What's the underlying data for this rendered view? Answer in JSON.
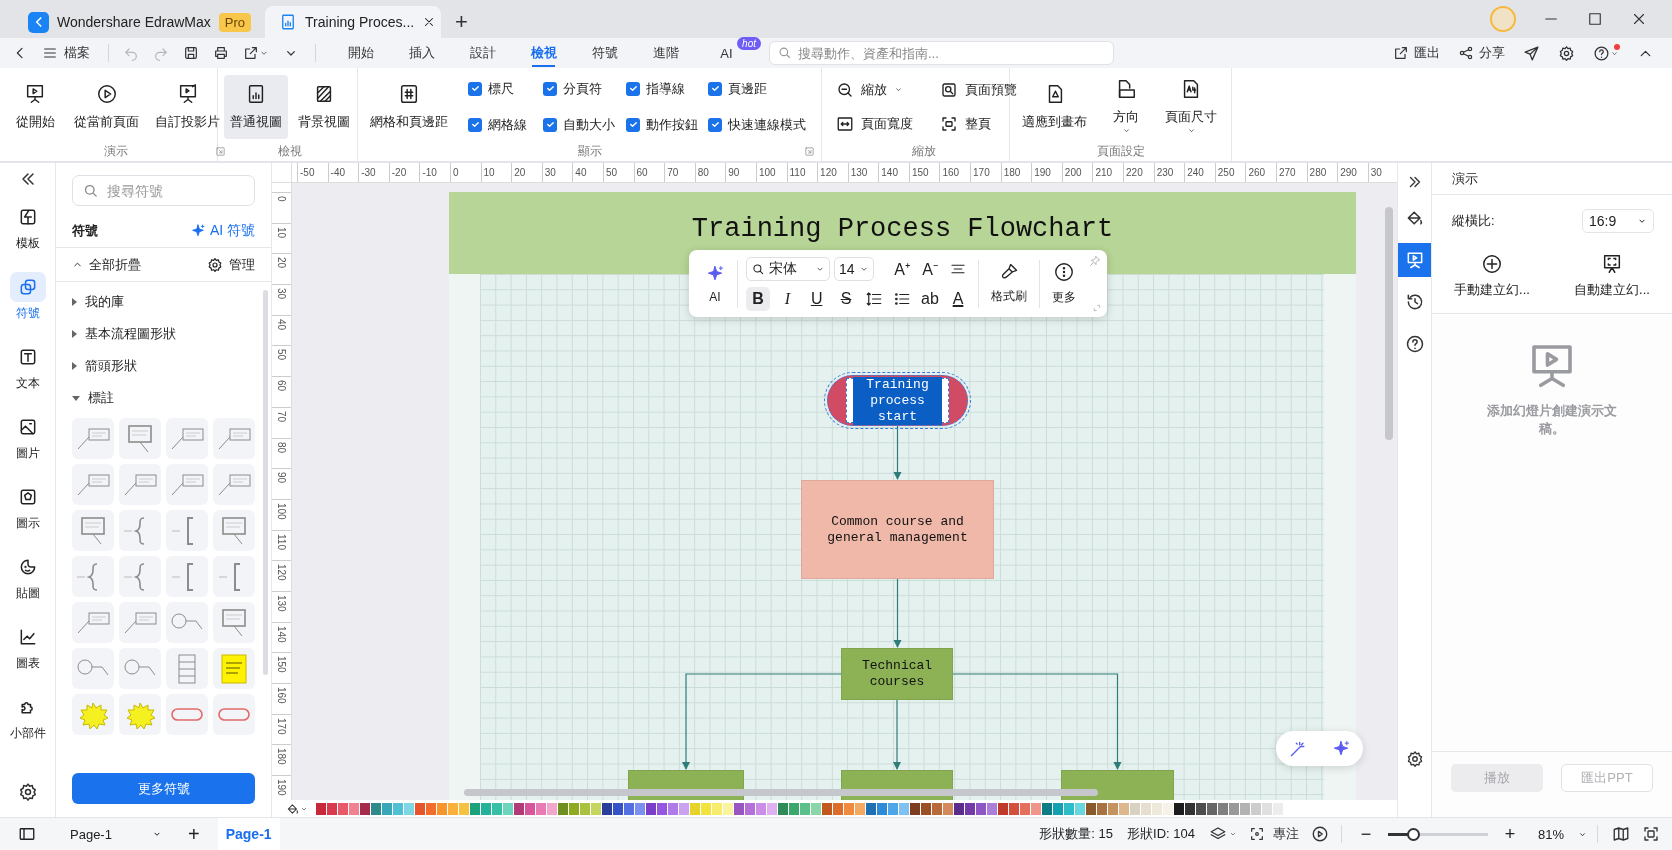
{
  "title_bar": {
    "tabs": [
      {
        "label": "Wondershare EdrawMax",
        "badge": "Pro",
        "selected": false
      },
      {
        "label": "Training Proces...",
        "selected": true
      }
    ],
    "new_tab": "+"
  },
  "menu_bar": {
    "file": "檔案",
    "tabs": [
      {
        "label": "開始",
        "selected": false
      },
      {
        "label": "插入",
        "selected": false
      },
      {
        "label": "設計",
        "selected": false
      },
      {
        "label": "檢視",
        "selected": true
      },
      {
        "label": "符號",
        "selected": false
      },
      {
        "label": "進階",
        "selected": false
      },
      {
        "label": "AI",
        "badge": "hot",
        "selected": false
      }
    ],
    "search": {
      "placeholder": "搜尋動作、資產和指南..."
    },
    "actions": [
      {
        "label": "匯出"
      },
      {
        "label": "分享"
      }
    ]
  },
  "ribbon": {
    "groups": [
      {
        "title": "演示",
        "launcher": true,
        "items": [
          {
            "kind": "large",
            "label": "從開始"
          },
          {
            "kind": "large",
            "label": "從當前頁面"
          },
          {
            "kind": "large",
            "label": "自訂投影片"
          }
        ]
      },
      {
        "title": "檢視",
        "launcher": false,
        "items": [
          {
            "kind": "large",
            "label": "普通視圖",
            "selected": true
          },
          {
            "kind": "large",
            "label": "背景視圖",
            "selected": false
          }
        ]
      },
      {
        "title": "顯示",
        "launcher": true,
        "items": [
          {
            "kind": "large",
            "label": "網格和頁邊距"
          },
          {
            "kind": "checks",
            "options": [
              {
                "label": "標尺",
                "checked": true
              },
              {
                "label": "分頁符",
                "checked": true
              },
              {
                "label": "指導線",
                "checked": true
              },
              {
                "label": "頁邊距",
                "checked": true
              },
              {
                "label": "網格線",
                "checked": true
              },
              {
                "label": "自動大小",
                "checked": true
              },
              {
                "label": "動作按鈕",
                "checked": true
              },
              {
                "label": "快速連線模式",
                "checked": true
              }
            ]
          }
        ]
      },
      {
        "title": "縮放",
        "launcher": false,
        "items": [
          {
            "kind": "small",
            "label": "縮放",
            "dropdown": true
          },
          {
            "kind": "small",
            "label": "頁面預覽",
            "dropdown": false
          },
          {
            "kind": "small",
            "label": "頁面寬度",
            "dropdown": false
          },
          {
            "kind": "small",
            "label": "整頁",
            "dropdown": false
          }
        ]
      },
      {
        "title": "頁面設定",
        "launcher": false,
        "items": [
          {
            "kind": "large",
            "label": "適應到畫布",
            "dropdown": false
          },
          {
            "kind": "large",
            "label": "方向",
            "dropdown": true
          },
          {
            "kind": "large",
            "label": "頁面尺寸",
            "dropdown": true
          }
        ]
      }
    ]
  },
  "left_rail": {
    "items": [
      {
        "label": "模板",
        "selected": false
      },
      {
        "label": "符號",
        "selected": true
      },
      {
        "label": "文本",
        "selected": false
      },
      {
        "label": "圖片",
        "selected": false
      },
      {
        "label": "圖示",
        "selected": false
      },
      {
        "label": "貼圖",
        "selected": false
      },
      {
        "label": "圖表",
        "selected": false
      },
      {
        "label": "小部件",
        "selected": false
      }
    ]
  },
  "symbol_panel": {
    "search": {
      "placeholder": "搜尋符號"
    },
    "title": "符號",
    "ai_link": "AI 符號",
    "collapse_all": "全部折疊",
    "manage": "管理",
    "categories": [
      {
        "label": "我的庫",
        "expanded": false
      },
      {
        "label": "基本流程圖形狀",
        "expanded": false
      },
      {
        "label": "箭頭形狀",
        "expanded": false
      },
      {
        "label": "標註",
        "expanded": true,
        "shapes": [
          {
            "kind": "line-callout"
          },
          {
            "kind": "box-callout"
          },
          {
            "kind": "line-callout"
          },
          {
            "kind": "line-callout"
          },
          {
            "kind": "line-callout"
          },
          {
            "kind": "line-callout"
          },
          {
            "kind": "line-callout"
          },
          {
            "kind": "line-callout"
          },
          {
            "kind": "box-callout"
          },
          {
            "kind": "brace"
          },
          {
            "kind": "bracket"
          },
          {
            "kind": "box-callout"
          },
          {
            "kind": "brace"
          },
          {
            "kind": "brace"
          },
          {
            "kind": "bracket"
          },
          {
            "kind": "bracket"
          },
          {
            "kind": "line-callout"
          },
          {
            "kind": "line-callout"
          },
          {
            "kind": "circle-callout"
          },
          {
            "kind": "box-callout"
          },
          {
            "kind": "circle-callout"
          },
          {
            "kind": "circle-callout"
          },
          {
            "kind": "list"
          },
          {
            "kind": "note"
          },
          {
            "kind": "burst"
          },
          {
            "kind": "burst"
          },
          {
            "kind": "pill"
          },
          {
            "kind": "pill"
          }
        ]
      }
    ],
    "more_button": "更多符號"
  },
  "canvas": {
    "ruler": {
      "horizontal": [
        "-50",
        "-40",
        "-30",
        "-20",
        "-10",
        "0",
        "10",
        "20",
        "30",
        "40",
        "50",
        "60",
        "70",
        "80",
        "90",
        "100",
        "110",
        "120",
        "130",
        "140",
        "150",
        "160",
        "170",
        "180",
        "190",
        "200",
        "210",
        "220",
        "230",
        "240",
        "250",
        "260",
        "270",
        "280",
        "290",
        "30"
      ],
      "vertical": [
        "0",
        "10",
        "20",
        "30",
        "40",
        "50",
        "60",
        "70",
        "80",
        "90",
        "100",
        "110",
        "120",
        "130",
        "140",
        "150",
        "160",
        "170",
        "180",
        "190"
      ]
    },
    "page": {
      "title": "Training Process Flowchart",
      "nodes": [
        {
          "kind": "terminator",
          "text": "Training process start",
          "color": "#d24b64",
          "selected": true
        },
        {
          "kind": "process",
          "text": "Common course and general management",
          "color": "#efb8a8",
          "selected": false
        },
        {
          "kind": "process",
          "text": "Technical courses",
          "color": "#8cb255",
          "selected": false
        },
        {
          "kind": "process",
          "color": "#8cb255",
          "selected": false
        },
        {
          "kind": "process",
          "color": "#8cb255",
          "selected": false
        },
        {
          "kind": "process",
          "color": "#8cb255",
          "selected": false
        }
      ]
    },
    "text_toolbar": {
      "ai_label": "AI",
      "font": "宋体",
      "size": "14",
      "buttons": [
        {
          "kind": "grow",
          "glyph": "A⁺",
          "selected": false
        },
        {
          "kind": "shrink",
          "glyph": "A⁻",
          "selected": false
        },
        {
          "kind": "align",
          "selected": false
        },
        {
          "kind": "bold",
          "glyph": "B",
          "selected": true
        },
        {
          "kind": "italic",
          "glyph": "I",
          "selected": false
        },
        {
          "kind": "underline",
          "glyph": "U",
          "selected": false
        },
        {
          "kind": "strike",
          "glyph": "S",
          "selected": false
        },
        {
          "kind": "spacing",
          "selected": false
        },
        {
          "kind": "list",
          "selected": false
        },
        {
          "kind": "case",
          "glyph": "ab",
          "selected": false
        },
        {
          "kind": "color",
          "glyph": "A",
          "selected": false
        }
      ],
      "format_painter": "格式刷",
      "more": "更多"
    },
    "palette": {
      "colors": [
        {
          "color": "#c8283c"
        },
        {
          "color": "#d83a4e"
        },
        {
          "color": "#e8596a"
        },
        {
          "color": "#f08291"
        },
        {
          "color": "#a52a4c"
        },
        {
          "color": "#2e8b8b"
        },
        {
          "color": "#3aa6b9"
        },
        {
          "color": "#4fc1d3"
        },
        {
          "color": "#7ed7e3"
        },
        {
          "color": "#e8542b"
        },
        {
          "color": "#f26c2b"
        },
        {
          "color": "#f7942c"
        },
        {
          "color": "#fbb03b"
        },
        {
          "color": "#f5c242"
        },
        {
          "color": "#1aa37a"
        },
        {
          "color": "#22b39a"
        },
        {
          "color": "#36c0a5"
        },
        {
          "color": "#6dd4bd"
        },
        {
          "color": "#b23a77"
        },
        {
          "color": "#d6559b"
        },
        {
          "color": "#e87bb4"
        },
        {
          "color": "#f2a6cc"
        },
        {
          "color": "#6f8f1e"
        },
        {
          "color": "#8eaa1f"
        },
        {
          "color": "#a9c23f"
        },
        {
          "color": "#c4d65f"
        },
        {
          "color": "#2c3e9c"
        },
        {
          "color": "#3652c7"
        },
        {
          "color": "#5470e0"
        },
        {
          "color": "#7b8ff0"
        },
        {
          "color": "#7a3ec8"
        },
        {
          "color": "#9656e0"
        },
        {
          "color": "#b07be8"
        },
        {
          "color": "#cba2f0"
        },
        {
          "color": "#e6d229"
        },
        {
          "color": "#f2e33d"
        },
        {
          "color": "#f7ec6e"
        },
        {
          "color": "#faf3a0"
        },
        {
          "color": "#9a55c2"
        },
        {
          "color": "#b46fd9"
        },
        {
          "color": "#cb8de6"
        },
        {
          "color": "#e0b1f0"
        },
        {
          "color": "#2e8b57"
        },
        {
          "color": "#3aa76d"
        },
        {
          "color": "#5cc08a"
        },
        {
          "color": "#8ad6a9"
        },
        {
          "color": "#c2571f"
        },
        {
          "color": "#dc6d2b"
        },
        {
          "color": "#ef8a3e"
        },
        {
          "color": "#f5a861"
        },
        {
          "color": "#1f6fb2"
        },
        {
          "color": "#2d8ad6"
        },
        {
          "color": "#4ea5e8"
        },
        {
          "color": "#7fc1f0"
        },
        {
          "color": "#7d3d1e"
        },
        {
          "color": "#9c4f25"
        },
        {
          "color": "#b86a3a"
        },
        {
          "color": "#d38a5c"
        },
        {
          "color": "#5a2d8a"
        },
        {
          "color": "#733ba8"
        },
        {
          "color": "#8f57c4"
        },
        {
          "color": "#ab7ed8"
        },
        {
          "color": "#c03a2b"
        },
        {
          "color": "#d4503d"
        },
        {
          "color": "#e36f5c"
        },
        {
          "color": "#ef958a"
        },
        {
          "color": "#0e7c86"
        },
        {
          "color": "#14a0ad"
        },
        {
          "color": "#2fbcc9"
        },
        {
          "color": "#6ad6de"
        },
        {
          "color": "#8a5a2b"
        },
        {
          "color": "#a87341"
        },
        {
          "color": "#c4935f"
        },
        {
          "color": "#dcb88c"
        },
        {
          "color": "#d9d1c1"
        },
        {
          "color": "#e6dfcf"
        },
        {
          "color": "#efe9dc"
        },
        {
          "color": "#f6f2e9"
        },
        {
          "color": "#1c1c1c"
        },
        {
          "color": "#333333"
        },
        {
          "color": "#4d4d4d"
        },
        {
          "color": "#666666"
        },
        {
          "color": "#808080"
        },
        {
          "color": "#999999"
        },
        {
          "color": "#b3b3b3"
        },
        {
          "color": "#cccccc"
        },
        {
          "color": "#e0e0e0"
        },
        {
          "color": "#ededed"
        }
      ]
    }
  },
  "right_rail": {
    "items": [
      {
        "kind": "style",
        "selected": false
      },
      {
        "kind": "presentation",
        "selected": true
      },
      {
        "kind": "history",
        "selected": false
      },
      {
        "kind": "help",
        "selected": false
      }
    ]
  },
  "right_panel": {
    "title": "演示",
    "aspect": {
      "label": "縱橫比:",
      "value": "16:9"
    },
    "actions": [
      {
        "kind": "manual",
        "label": "手動建立幻..."
      },
      {
        "kind": "auto",
        "label": "自動建立幻..."
      }
    ],
    "empty_message": "添加幻燈片創建演示文稿。",
    "buttons": [
      {
        "kind": "primary",
        "label": "播放",
        "disabled": true
      },
      {
        "kind": "secondary",
        "label": "匯出PPT",
        "disabled": true
      }
    ]
  },
  "status_bar": {
    "page_select": "Page-1",
    "add_page": "+",
    "pages": [
      {
        "label": "Page-1",
        "selected": true
      }
    ],
    "shape_count": "形狀數量: 15",
    "shape_id": "形狀ID: 104",
    "focus": "專注",
    "zoom": {
      "minus": "−",
      "plus": "+",
      "level": 0.25,
      "reading": "81%"
    }
  }
}
